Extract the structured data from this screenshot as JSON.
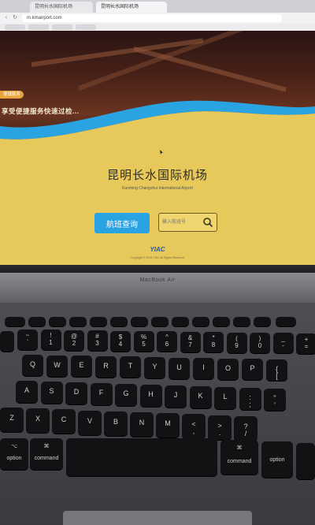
{
  "browser": {
    "tabs": [
      "昆明长水国际机场",
      "昆明长水国际机场"
    ],
    "url": "m.kmairport.com"
  },
  "hero": {
    "badge": "便捷服务",
    "text": "享受便捷服务快速过检..."
  },
  "page": {
    "title": "昆明长水国际机场",
    "subtitle": "Kunming Changshui International Airport",
    "flight_button": "航班查询",
    "search_placeholder": "输入航班号",
    "logo_text": "YIAC",
    "footnote": "Copyright © 2016 YIAC All Rights Reserved"
  },
  "laptop": {
    "brand": "MacBook Air"
  },
  "keyboard": {
    "row_num": [
      "~\n`",
      "!\n1",
      "@\n2",
      "#\n3",
      "$\n4",
      "%\n5",
      "^\n6",
      "&\n7",
      "*\n8",
      "(\n9",
      ")\n0",
      "_\n-",
      "+\n="
    ],
    "row_q": [
      "Q",
      "W",
      "E",
      "R",
      "T",
      "Y",
      "U",
      "I",
      "O",
      "P",
      "{\n["
    ],
    "row_a": [
      "A",
      "S",
      "D",
      "F",
      "G",
      "H",
      "J",
      "K",
      "L",
      ":\n;",
      "\"\n'"
    ],
    "row_z": [
      "Z",
      "X",
      "C",
      "V",
      "B",
      "N",
      "M",
      "<\n,",
      ">\n.",
      "?\n/"
    ],
    "bottom": {
      "option_left": "option",
      "command_left": "command",
      "command_right": "command",
      "option_right": "option"
    }
  },
  "colors": {
    "accent": "#2aa3e2",
    "background": "#e7c85a",
    "wave": "#2aa3e2"
  }
}
